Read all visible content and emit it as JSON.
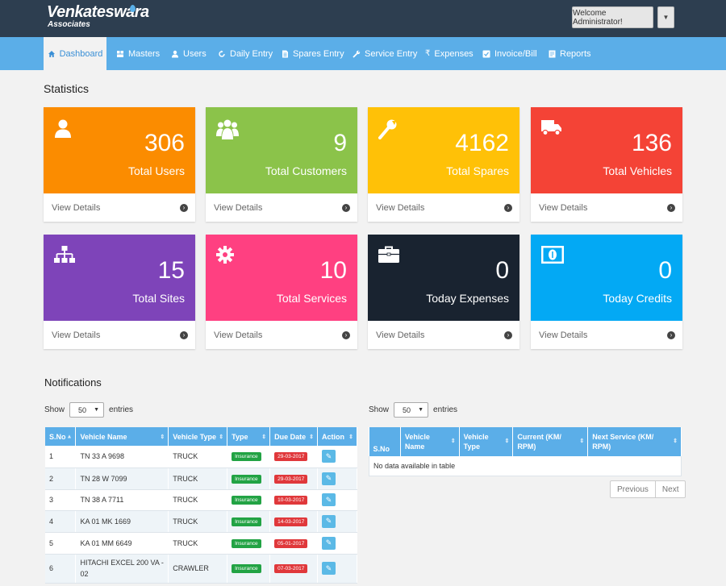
{
  "header": {
    "logo_main": "Venkateswara",
    "logo_sub": "Associates",
    "welcome": "Welcome Administrator!"
  },
  "nav": [
    {
      "label": "Dashboard",
      "icon": "home-icon"
    },
    {
      "label": "Masters",
      "icon": "masters-icon"
    },
    {
      "label": "Users",
      "icon": "user-icon"
    },
    {
      "label": "Daily Entry",
      "icon": "refresh-icon"
    },
    {
      "label": "Spares Entry",
      "icon": "document-icon"
    },
    {
      "label": "Service Entry",
      "icon": "wrench-icon"
    },
    {
      "label": "Expenses",
      "icon": "rupee-icon"
    },
    {
      "label": "Invoice/Bill",
      "icon": "checkbox-icon"
    },
    {
      "label": "Reports",
      "icon": "report-icon"
    }
  ],
  "statistics_title": "Statistics",
  "cards": [
    {
      "value": "306",
      "label": "Total Users",
      "link": "View Details",
      "color": "#fb8c00",
      "icon": "user-icon"
    },
    {
      "value": "9",
      "label": "Total Customers",
      "link": "View Details",
      "color": "#8bc34a",
      "icon": "users-group-icon"
    },
    {
      "value": "4162",
      "label": "Total Spares",
      "link": "View Details",
      "color": "#ffc107",
      "icon": "wrench-icon"
    },
    {
      "value": "136",
      "label": "Total Vehicles",
      "link": "View Details",
      "color": "#f44336",
      "icon": "truck-icon"
    },
    {
      "value": "15",
      "label": "Total Sites",
      "link": "View Details",
      "color": "#7e44b9",
      "icon": "sitemap-icon"
    },
    {
      "value": "10",
      "label": "Total Services",
      "link": "View Details",
      "color": "#ff4081",
      "icon": "gear-icon"
    },
    {
      "value": "0",
      "label": "Today Expenses",
      "link": "View Details",
      "color": "#192330",
      "icon": "briefcase-icon"
    },
    {
      "value": "0",
      "label": "Today Credits",
      "link": "View Details",
      "color": "#03a9f4",
      "icon": "money-icon"
    }
  ],
  "notifications_title": "Notifications",
  "table1": {
    "show": "Show",
    "entries": "entries",
    "page_size": "50",
    "headers": [
      "S.No",
      "Vehicle Name",
      "Vehicle Type",
      "Type",
      "Due Date",
      "Action"
    ],
    "rows": [
      {
        "sno": "1",
        "name": "TN 33 A 9698",
        "vtype": "TRUCK",
        "type": "Insurance",
        "due": "29-03-2017"
      },
      {
        "sno": "2",
        "name": "TN 28 W 7099",
        "vtype": "TRUCK",
        "type": "Insurance",
        "due": "29-03-2017"
      },
      {
        "sno": "3",
        "name": "TN 38 A 7711",
        "vtype": "TRUCK",
        "type": "Insurance",
        "due": "10-03-2017"
      },
      {
        "sno": "4",
        "name": "KA 01 MK 1669",
        "vtype": "TRUCK",
        "type": "Insurance",
        "due": "14-03-2017"
      },
      {
        "sno": "5",
        "name": "KA 01 MM 6649",
        "vtype": "TRUCK",
        "type": "Insurance",
        "due": "05-01-2017"
      },
      {
        "sno": "6",
        "name": "HITACHI EXCEL 200 VA - 02",
        "vtype": "CRAWLER",
        "type": "Insurance",
        "due": "07-03-2017"
      }
    ]
  },
  "table2": {
    "show": "Show",
    "entries": "entries",
    "page_size": "50",
    "headers": [
      "S.No",
      "Vehicle Name",
      "Vehicle Type",
      "Current (KM/ RPM)",
      "Next Service (KM/ RPM)"
    ],
    "empty": "No data available in table",
    "previous": "Previous",
    "next": "Next"
  }
}
